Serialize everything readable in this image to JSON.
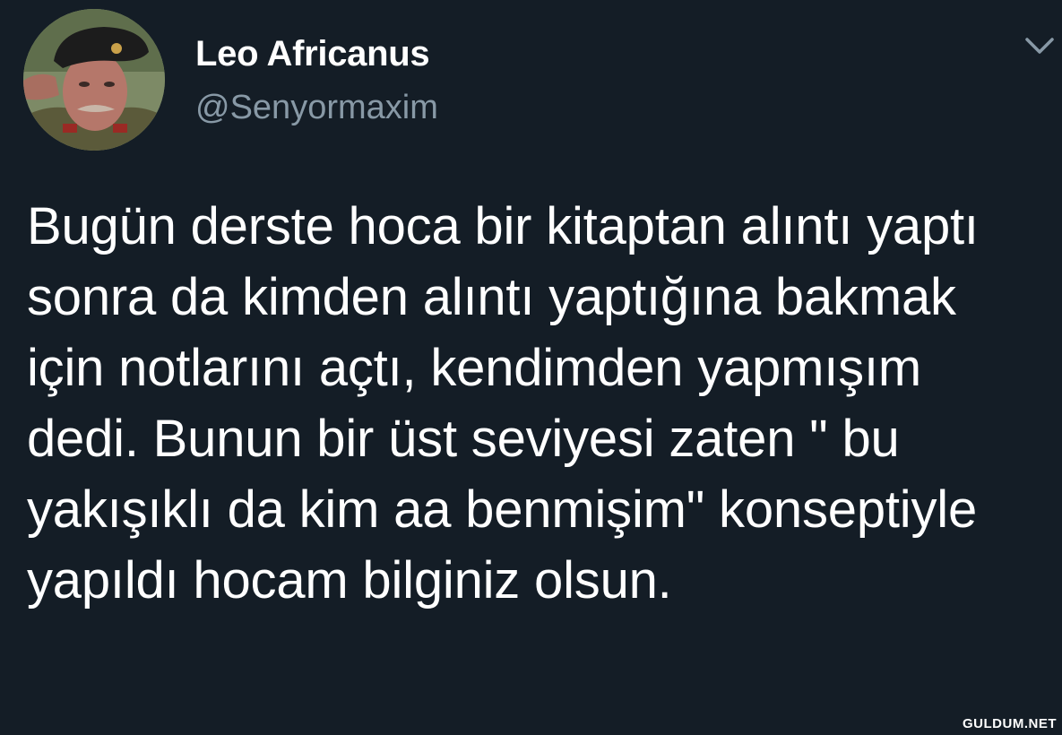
{
  "tweet": {
    "author": {
      "display_name": "Leo Africanus",
      "handle": "@Senyormaxim"
    },
    "text": "Bugün derste hoca bir kitaptan alıntı yaptı sonra da kimden alıntı yaptığına bakmak için notlarını açtı, kendimden yapmışım dedi. Bunun bir üst seviyesi zaten \" bu yakışıklı da kim aa benmişim\" konseptiyle yapıldı hocam bilginiz olsun."
  },
  "icons": {
    "menu": "chevron-down-icon"
  },
  "colors": {
    "background": "#141d26",
    "primary_text": "#ffffff",
    "secondary_text": "#8899a6"
  },
  "watermark": "GULDUM.NET"
}
